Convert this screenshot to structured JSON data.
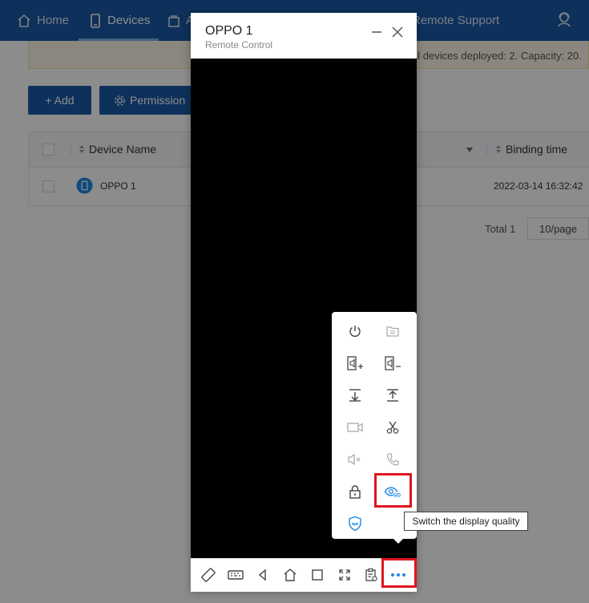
{
  "nav": {
    "items": [
      {
        "label": "Home",
        "icon": "home-icon"
      },
      {
        "label": "Devices",
        "icon": "phone-icon"
      },
      {
        "label": "A",
        "icon": "bag-icon"
      },
      {
        "label": "Remote Support",
        "icon": "support-icon"
      }
    ],
    "active": "Devices",
    "user_icon": "user-headset-icon"
  },
  "notice": {
    "text": "al devices deployed: 2. Capacity: 20."
  },
  "buttons": {
    "add": "+ Add",
    "permission": "Permission"
  },
  "table": {
    "columns": {
      "device_name": "Device Name",
      "binding_time": "Binding time"
    },
    "rows": [
      {
        "device_name": "OPPO 1",
        "binding_time": "2022-03-14 16:32:42"
      }
    ]
  },
  "pagination": {
    "total": "Total 1",
    "page_size": "10/page"
  },
  "remote": {
    "title": "OPPO 1",
    "subtitle": "Remote Control",
    "toolbar": [
      "rotate-icon",
      "keyboard-icon",
      "back-icon",
      "home-icon",
      "recent-apps-icon",
      "fullscreen-icon",
      "clipboard-icon",
      "more-icon"
    ],
    "menu": [
      "power-icon",
      "file-icon",
      "volume-up-icon",
      "volume-down-icon",
      "pull-down-icon",
      "push-up-icon",
      "video-icon",
      "scissors-icon",
      "mute-icon",
      "phone-call-icon",
      "lock-icon",
      "display-quality-icon",
      "privacy-shield-icon"
    ],
    "tooltip": "Switch the display quality"
  },
  "colors": {
    "nav": "#1a5aa7",
    "accent": "#1e88e5",
    "highlight": "#e0141e"
  }
}
